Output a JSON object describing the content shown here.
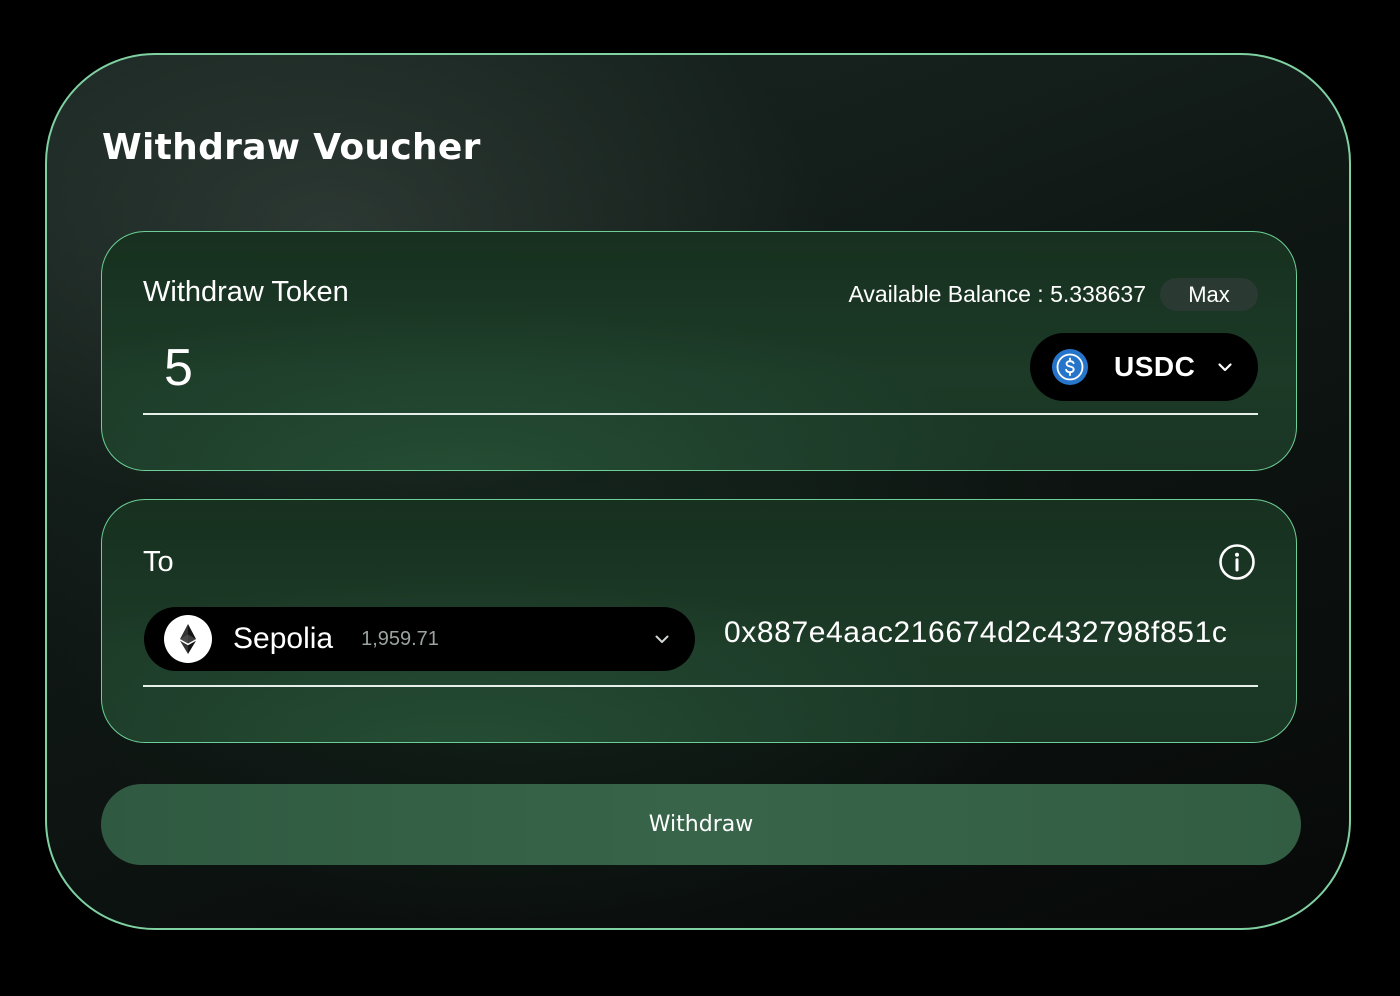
{
  "title": "Withdraw Voucher",
  "withdraw_token": {
    "label": "Withdraw Token",
    "balance_text": "Available Balance : 5.338637",
    "max_label": "Max",
    "amount": "5",
    "token": {
      "symbol": "USDC",
      "icon": "usdc-coin-icon",
      "color": "#2775CA"
    }
  },
  "to": {
    "label": "To",
    "info_icon": "info-icon",
    "network": {
      "name": "Sepolia",
      "balance": "1,959.71",
      "icon": "ethereum-icon"
    },
    "address": "0x887e4aac216674d2c432798f851c"
  },
  "withdraw_button": {
    "label": "Withdraw"
  },
  "colors": {
    "accent_border": "#7fd1a2",
    "button": "#356048",
    "background": "#000000"
  }
}
